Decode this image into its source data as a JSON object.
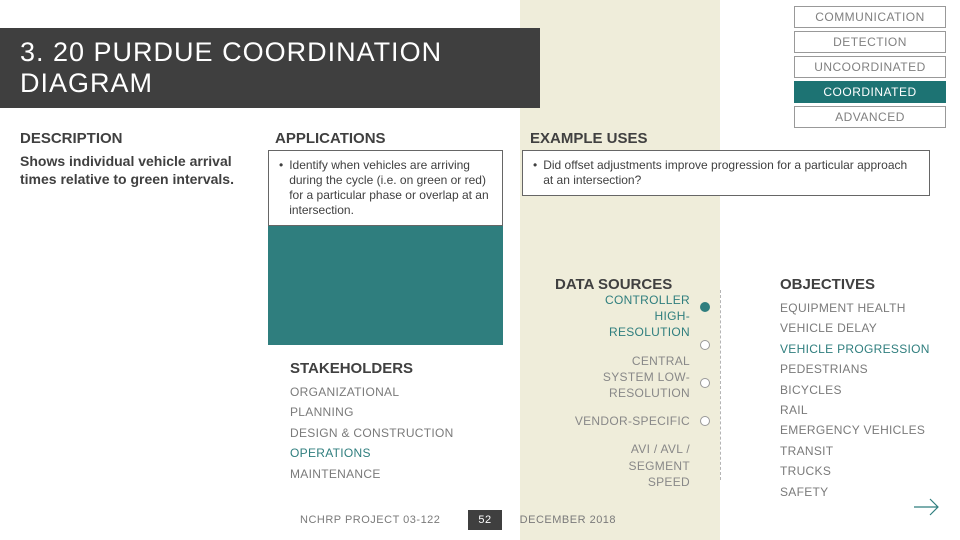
{
  "header": {
    "title": "3. 20 PURDUE COORDINATION DIAGRAM"
  },
  "tags": {
    "t0": "COMMUNICATION",
    "t1": "DETECTION",
    "t2": "UNCOORDINATED",
    "t3": "COORDINATED",
    "t4": "ADVANCED"
  },
  "columns": {
    "description_label": "DESCRIPTION",
    "applications_label": "APPLICATIONS",
    "example_label": "EXAMPLE USES"
  },
  "description_text": "Shows individual vehicle arrival times relative to green intervals.",
  "applications_bullet": "Identify when vehicles are arriving during the cycle (i.e. on green or red) for a particular phase or overlap at an intersection.",
  "example_bullet": "Did offset adjustments improve progression for a particular approach at an intersection?",
  "stakeholders": {
    "label": "STAKEHOLDERS",
    "items": {
      "s0": "ORGANIZATIONAL",
      "s1": "PLANNING",
      "s2": "DESIGN & CONSTRUCTION",
      "s3": "OPERATIONS",
      "s4": "MAINTENANCE"
    }
  },
  "data_sources": {
    "label": "DATA SOURCES",
    "g0a": "CONTROLLER",
    "g0b": "HIGH-",
    "g0c": "RESOLUTION",
    "g1a": "CENTRAL",
    "g1b": "SYSTEM LOW-",
    "g1c": "RESOLUTION",
    "g2": "VENDOR-SPECIFIC",
    "g3a": "AVI / AVL /",
    "g3b": "SEGMENT",
    "g3c": "SPEED"
  },
  "objectives": {
    "label": "OBJECTIVES",
    "o0": "EQUIPMENT HEALTH",
    "o1": "VEHICLE DELAY",
    "o2": "VEHICLE PROGRESSION",
    "o3": "PEDESTRIANS",
    "o4": "BICYCLES",
    "o5": "RAIL",
    "o6": "EMERGENCY VEHICLES",
    "o7": "TRANSIT",
    "o8": "TRUCKS",
    "o9": "SAFETY"
  },
  "footer": {
    "project": "NCHRP PROJECT 03-122",
    "page": "52",
    "date": "DECEMBER 2018"
  }
}
